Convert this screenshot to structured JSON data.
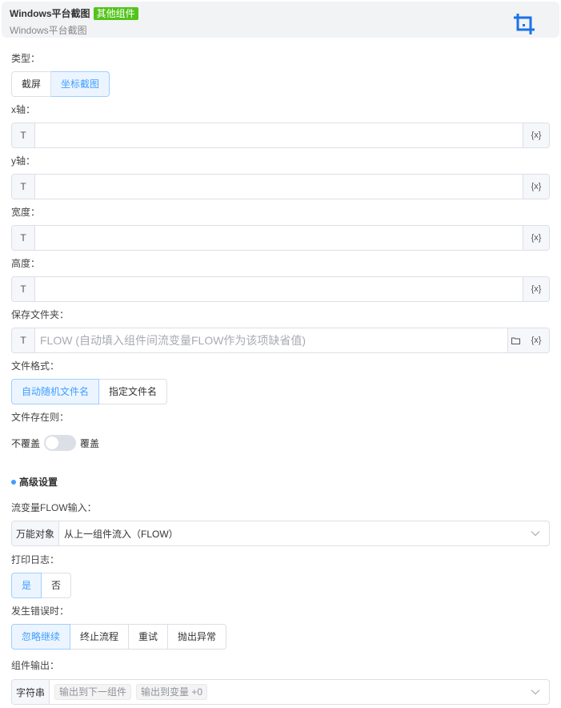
{
  "header": {
    "title": "Windows平台截图",
    "badge": "其他组件",
    "subtitle": "Windows平台截图",
    "accent": "#1a73e8",
    "badge_color": "#52c41a",
    "icon": "crop-icon"
  },
  "type_field": {
    "label": "类型：",
    "options": [
      "截屏",
      "坐标截图"
    ],
    "selected": "坐标截图"
  },
  "x_field": {
    "label": "x轴：",
    "prefix": "T",
    "value": "",
    "var_label": "{x}"
  },
  "y_field": {
    "label": "y轴：",
    "prefix": "T",
    "value": "",
    "var_label": "{x}"
  },
  "width_field": {
    "label": "宽度：",
    "prefix": "T",
    "value": "",
    "var_label": "{x}"
  },
  "height_field": {
    "label": "高度：",
    "prefix": "T",
    "value": "",
    "var_label": "{x}"
  },
  "folder_field": {
    "label": "保存文件夹：",
    "prefix": "T",
    "placeholder": "FLOW (自动填入组件间流变量FLOW作为该项缺省值)",
    "value": "",
    "var_label": "{x}",
    "folder_icon": "folder-icon"
  },
  "file_format": {
    "label": "文件格式：",
    "options": [
      "自动随机文件名",
      "指定文件名"
    ],
    "selected": "自动随机文件名"
  },
  "file_exists": {
    "label": "文件存在则：",
    "off_label": "不覆盖",
    "on_label": "覆盖",
    "on": false
  },
  "advanced": {
    "title": "高级设置"
  },
  "flow_input": {
    "label": "流变量FLOW输入：",
    "prefix": "万能对象",
    "value": "从上一组件流入（FLOW）"
  },
  "print_log": {
    "label": "打印日志：",
    "options": [
      "是",
      "否"
    ],
    "selected": "是"
  },
  "on_error": {
    "label": "发生错误时：",
    "options": [
      "忽略继续",
      "终止流程",
      "重试",
      "抛出异常"
    ],
    "selected": "忽略继续"
  },
  "output": {
    "label": "组件输出：",
    "prefix": "字符串",
    "tags": [
      "输出到下一组件",
      "输出到变量 +0"
    ]
  }
}
